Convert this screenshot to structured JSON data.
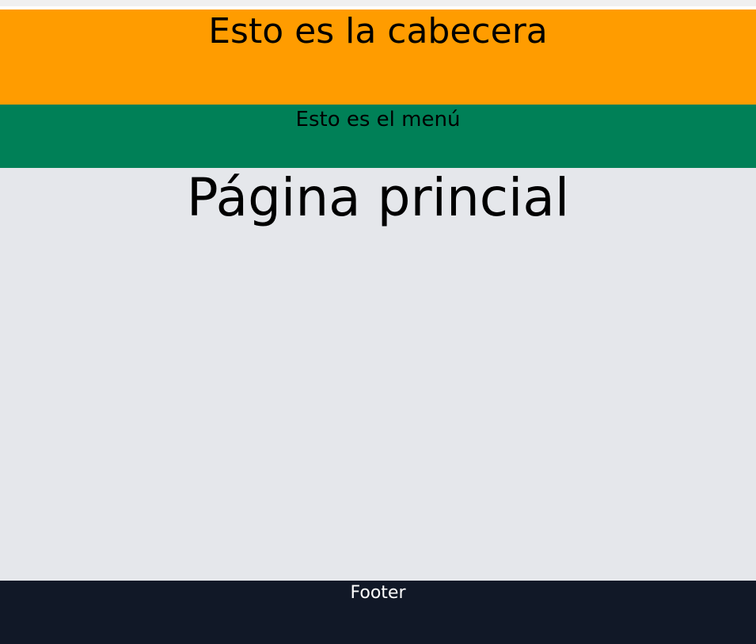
{
  "colors": {
    "header_bg": "#ff9c00",
    "menu_bg": "#008057",
    "main_bg": "#e5e7eb",
    "footer_bg": "#111827",
    "text_dark": "#000000",
    "text_light": "#ffffff"
  },
  "header": {
    "title": "Esto es la cabecera"
  },
  "menu": {
    "label": "Esto es el menú"
  },
  "main": {
    "title": "Página princial"
  },
  "footer": {
    "label": "Footer"
  }
}
